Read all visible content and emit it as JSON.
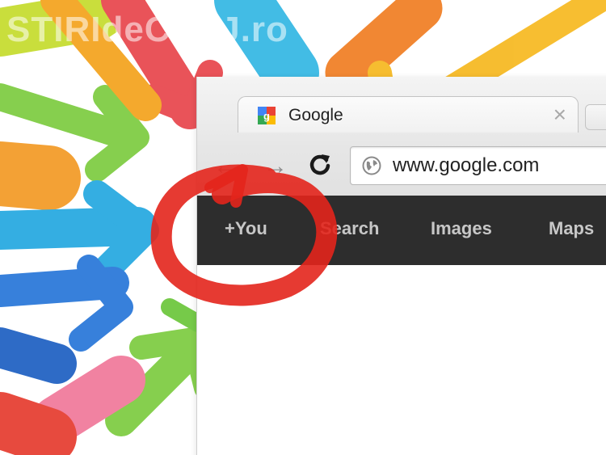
{
  "watermark": "STIRIdeCLUJ.ro",
  "browser": {
    "tab": {
      "title": "Google",
      "favicon": "google-g-icon",
      "close_glyph": "×"
    },
    "toolbar": {
      "back_icon": "back-arrow-icon",
      "forward_icon": "forward-arrow-icon",
      "reload_icon": "reload-icon"
    },
    "address_bar": {
      "url": "www.google.com",
      "icon": "globe-icon"
    }
  },
  "google_bar": {
    "items": [
      {
        "label": "+You"
      },
      {
        "label": "Search"
      },
      {
        "label": "Images"
      },
      {
        "label": "Maps"
      }
    ]
  },
  "colors": {
    "gbar_bg": "#2d2d2d",
    "gbar_text": "#c7c7c7",
    "circle_red": "#e3251c"
  }
}
